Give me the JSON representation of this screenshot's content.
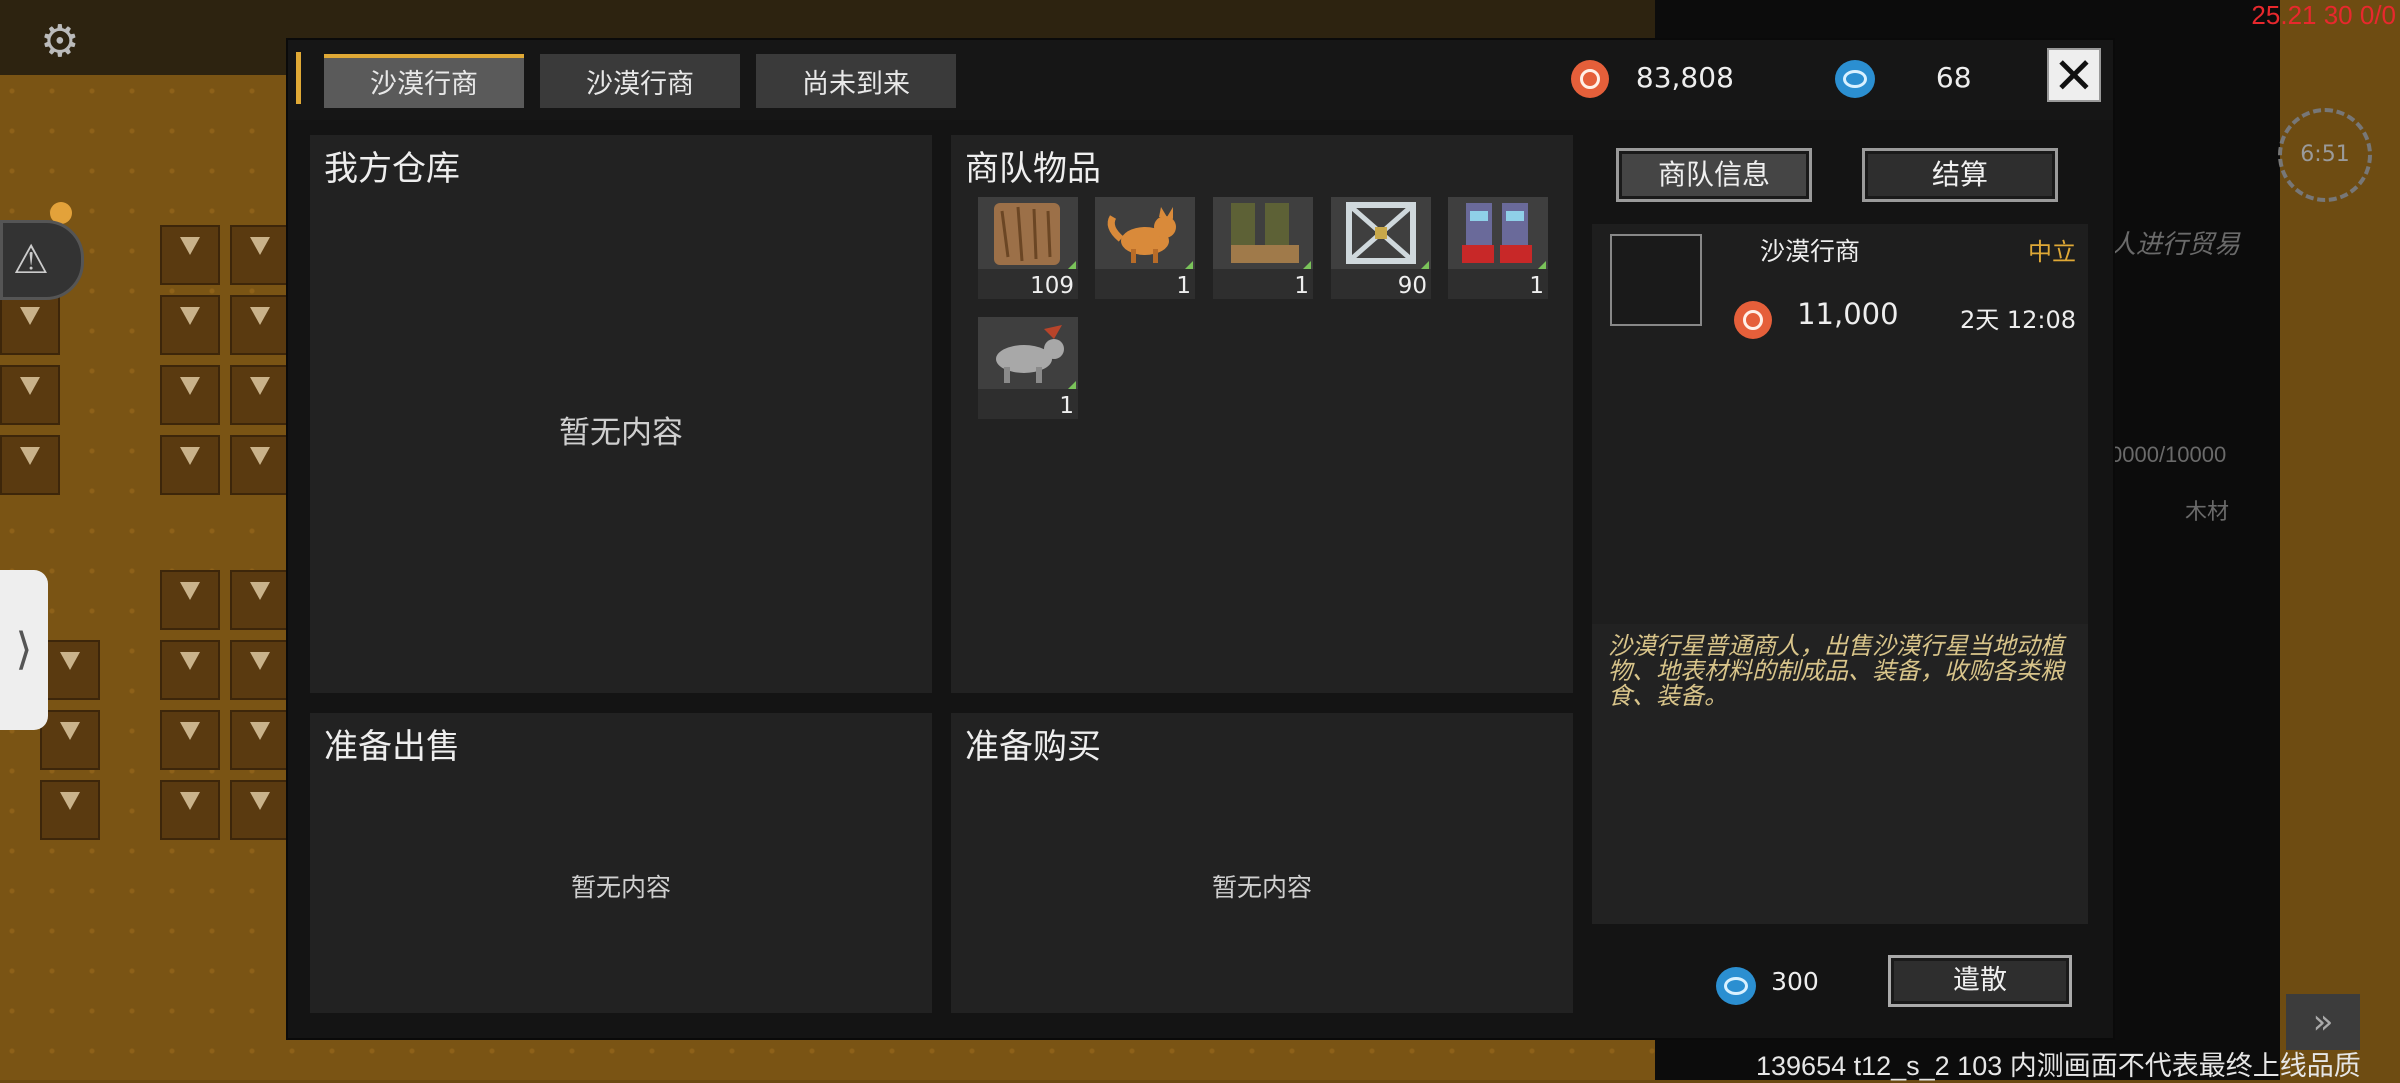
{
  "debug": {
    "top_right": "25.21 30 0/0",
    "bottom": "139654 t12_s_2 103  内测画面不代表最终上线品质"
  },
  "background": {
    "timer": "6:51",
    "trade_hint": "人进行贸易",
    "capacity": "0000/10000",
    "resource": "木材"
  },
  "tabs": [
    {
      "label": "沙漠行商",
      "active": true
    },
    {
      "label": "沙漠行商",
      "active": false
    },
    {
      "label": "尚未到来",
      "active": false
    }
  ],
  "currencies": {
    "coins": "83,808",
    "gems": "68"
  },
  "panels": {
    "my_warehouse": {
      "title": "我方仓库",
      "empty": "暂无内容"
    },
    "caravan_items": {
      "title": "商队物品"
    },
    "ready_to_sell": {
      "title": "准备出售",
      "empty": "暂无内容"
    },
    "ready_to_buy": {
      "title": "准备购买",
      "empty": "暂无内容"
    }
  },
  "caravan_items": [
    {
      "icon": "wood-log-icon",
      "count": "109"
    },
    {
      "icon": "fox-icon",
      "count": "1"
    },
    {
      "icon": "leather-boots-icon",
      "count": "1"
    },
    {
      "icon": "metal-frame-icon",
      "count": "90"
    },
    {
      "icon": "red-boots-icon",
      "count": "1"
    },
    {
      "icon": "beast-creature-icon",
      "count": "1"
    }
  ],
  "buttons": {
    "caravan_info": "商队信息",
    "settle": "结算",
    "disband": "遣散"
  },
  "merchant": {
    "name": "沙漠行商",
    "stance": "中立",
    "coins": "11,000",
    "time_left": "2天 12:08",
    "description": "沙漠行星普通商人，出售沙漠行星当地动植物、地表材料的制成品、装备，收购各类粮食、装备。"
  },
  "footer": {
    "gem_cost": "300"
  },
  "colors": {
    "accent": "#e0a936",
    "coin": "#e55f3a",
    "gem": "#2b8fd1",
    "stance": "#e0a936",
    "description": "#d8c48a"
  }
}
